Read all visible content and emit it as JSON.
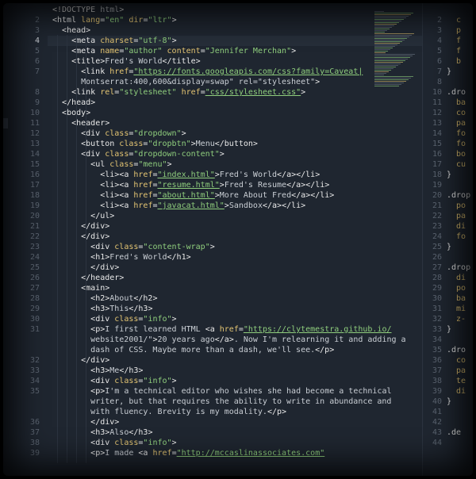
{
  "colors": {
    "background": "#1f2630",
    "tag": "#e9e9e9",
    "attribute": "#e3c472",
    "string": "#8fce7d",
    "line_number": "#5b6470"
  },
  "editor": {
    "left_lines": [
      {
        "n": "",
        "text": "<!DOCTYPE html>"
      },
      {
        "n": "2",
        "text": "<html lang=\"en\" dir=\"ltr\">"
      },
      {
        "n": "3",
        "text": "  <head>"
      },
      {
        "n": "4",
        "text": "    <meta charset=\"utf-8\">"
      },
      {
        "n": "5",
        "text": "    <meta name=\"author\" content=\"Jennifer Merchan\">"
      },
      {
        "n": "6",
        "text": "    <title>Fred's World</title>"
      },
      {
        "n": "7",
        "text": "      <link href=\"https://fonts.googleapis.com/css?family=Caveat|"
      },
      {
        "n": "",
        "text": "      Montserrat:400,600&display=swap\" rel=\"stylesheet\">"
      },
      {
        "n": "8",
        "text": "    <link rel=\"stylesheet\" href=\"css/stylesheet.css\">"
      },
      {
        "n": "9",
        "text": "  </head>"
      },
      {
        "n": "10",
        "text": "  <body>"
      },
      {
        "n": "11",
        "text": "    <header>"
      },
      {
        "n": "12",
        "text": "      <div class=\"dropdown\">"
      },
      {
        "n": "13",
        "text": "      <button class=\"dropbtn\">Menu</button>"
      },
      {
        "n": "14",
        "text": "      <div class=\"dropdown-content\">"
      },
      {
        "n": "15",
        "text": "        <ul class=\"menu\">"
      },
      {
        "n": "16",
        "text": "          <li><a href=\"index.html\">Fred's World</a></li>"
      },
      {
        "n": "17",
        "text": "          <li><a href=\"resume.html\">Fred's Resume</a></li>"
      },
      {
        "n": "18",
        "text": "          <li><a href=\"about.html\">More About Fred</a></li>"
      },
      {
        "n": "19",
        "text": "          <li><a href=\"javacat.html\">Sandbox</a></li>"
      },
      {
        "n": "20",
        "text": "        </ul>"
      },
      {
        "n": "21",
        "text": "      </div>"
      },
      {
        "n": "22",
        "text": "      </div>"
      },
      {
        "n": "23",
        "text": "        <div class=\"content-wrap\">"
      },
      {
        "n": "24",
        "text": "        <h1>Fred's World</h1>"
      },
      {
        "n": "25",
        "text": "        </div>"
      },
      {
        "n": "26",
        "text": "      </header>"
      },
      {
        "n": "27",
        "text": "      <main>"
      },
      {
        "n": "28",
        "text": "        <h2>About</h2>"
      },
      {
        "n": "29",
        "text": "        <h3>This</h3>"
      },
      {
        "n": "30",
        "text": "        <div class=\"info\">"
      },
      {
        "n": "31",
        "text": "        <p>I first learned HTML <a href=\"https://clytemestra.github.io/"
      },
      {
        "n": "",
        "text": "        website2001/\">20 years ago</a>. Now I'm relearning it and adding a"
      },
      {
        "n": "",
        "text": "        dash of CSS. Maybe more than a dash, we'll see.</p>"
      },
      {
        "n": "32",
        "text": "      </div>"
      },
      {
        "n": "33",
        "text": "        <h3>Me</h3>"
      },
      {
        "n": "34",
        "text": "        <div class=\"info\">"
      },
      {
        "n": "35",
        "text": "        <p>I'm a technical editor who wishes she had become a technical"
      },
      {
        "n": "",
        "text": "        writer, but that requires the ability to write in abundance and"
      },
      {
        "n": "",
        "text": "        with fluency. Brevity is my modality.</p>"
      },
      {
        "n": "36",
        "text": "        </div>"
      },
      {
        "n": "37",
        "text": "        <h3>Also</h3>"
      },
      {
        "n": "38",
        "text": "        <div class=\"info\">"
      },
      {
        "n": "39",
        "text": "        <p>I made <a href=\"http://mccaslinassociates.com\""
      }
    ],
    "right_lines": [
      {
        "n": "2",
        "text": "  c"
      },
      {
        "n": "3",
        "text": "  p"
      },
      {
        "n": "4",
        "text": "  f"
      },
      {
        "n": "5",
        "text": "  f"
      },
      {
        "n": "6",
        "text": "  b"
      },
      {
        "n": "7",
        "text": "}"
      },
      {
        "n": "8",
        "text": ""
      },
      {
        "n": "10",
        "text": ".dro"
      },
      {
        "n": "11",
        "text": "  ba"
      },
      {
        "n": "12",
        "text": "  co"
      },
      {
        "n": "13",
        "text": "  pa"
      },
      {
        "n": "14",
        "text": "  fo"
      },
      {
        "n": "15",
        "text": "  fo"
      },
      {
        "n": "16",
        "text": "  bo"
      },
      {
        "n": "17",
        "text": "  cu"
      },
      {
        "n": "18",
        "text": "}"
      },
      {
        "n": "19",
        "text": ""
      },
      {
        "n": "20",
        "text": ".drop"
      },
      {
        "n": "21",
        "text": "  po"
      },
      {
        "n": "22",
        "text": "  pa"
      },
      {
        "n": "23",
        "text": "  di"
      },
      {
        "n": "24",
        "text": "  fo"
      },
      {
        "n": "25",
        "text": "}"
      },
      {
        "n": "26",
        "text": ""
      },
      {
        "n": "27",
        "text": ".drop"
      },
      {
        "n": "28",
        "text": "  di"
      },
      {
        "n": "29",
        "text": "  po"
      },
      {
        "n": "30",
        "text": "  ba"
      },
      {
        "n": "31",
        "text": "  mi"
      },
      {
        "n": "32",
        "text": "  z-"
      },
      {
        "n": "33",
        "text": "}"
      },
      {
        "n": "34",
        "text": ""
      },
      {
        "n": "35",
        "text": ".dro"
      },
      {
        "n": "36",
        "text": "  co"
      },
      {
        "n": "37",
        "text": "  pa"
      },
      {
        "n": "38",
        "text": "  te"
      },
      {
        "n": "39",
        "text": "  di"
      },
      {
        "n": "40",
        "text": "}"
      },
      {
        "n": "41",
        "text": ""
      },
      {
        "n": "42",
        "text": ""
      },
      {
        "n": "43",
        "text": ".de"
      },
      {
        "n": "44",
        "text": ""
      }
    ]
  }
}
